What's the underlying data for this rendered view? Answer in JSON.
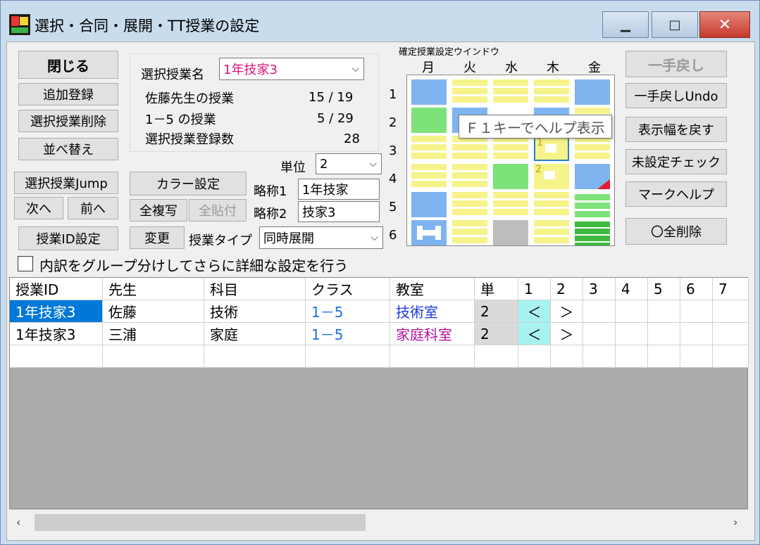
{
  "window": {
    "title": "選択・合同・展開・TT授業の設定",
    "min_glyph": "▁",
    "max_glyph": "□",
    "close_glyph": "✕"
  },
  "left_buttons": {
    "close": "閉じる",
    "add": "追加登録",
    "delete": "選択授業削除",
    "sort": "並べ替え",
    "jump": "選択授業Jump",
    "next": "次へ",
    "prev": "前へ",
    "lesson_id": "授業ID設定"
  },
  "group": {
    "select_label": "選択授業名",
    "select_value": "1年技家3",
    "row1_label": "佐藤先生の授業",
    "row1_value": "15 / 19",
    "row2_label": "1－5 の授業",
    "row2_value": "5 / 29",
    "row3_label": "選択授業登録数",
    "row3_value": "28"
  },
  "unit": {
    "label": "単位",
    "value": "2"
  },
  "mid_buttons": {
    "color": "カラー設定",
    "copy_all": "全複写",
    "paste_all": "全貼付",
    "change": "変更"
  },
  "abbr": {
    "label1": "略称1",
    "value1": "1年技家",
    "label2": "略称2",
    "value2": "技家3"
  },
  "lesson_type": {
    "label": "授業タイプ",
    "value": "同時展開"
  },
  "checkbox_label": "内訳をグループ分けしてさらに詳細な設定を行う",
  "timetable": {
    "title": "確定授業設定ウインドウ",
    "days": [
      "月",
      "火",
      "水",
      "木",
      "金"
    ],
    "periods": [
      "1",
      "2",
      "3",
      "4",
      "5",
      "6"
    ],
    "marker1": "1",
    "marker2": "2",
    "colors": {
      "blue": "#7fb3f0",
      "green": "#7ee27a",
      "yellow": "#f6f38a",
      "gray": "#bdbdbd",
      "red": "#e8192c"
    }
  },
  "tooltip": "Ｆ１キーでヘルプ表示",
  "right_buttons": {
    "undo": "一手戻し",
    "undo_undo": "一手戻しUndo",
    "restore_width": "表示幅を戻す",
    "unset_check": "未設定チェック",
    "mark_help": "マークヘルプ",
    "delete_all": "〇全削除"
  },
  "grid": {
    "headers": [
      "授業ID",
      "先生",
      "科目",
      "クラス",
      "教室",
      "単",
      "1",
      "2",
      "3",
      "4",
      "5",
      "6",
      "7"
    ],
    "rows": [
      {
        "id": "1年技家3",
        "teacher": "佐藤",
        "subject": "技術",
        "class": "1－5",
        "room": "技術室",
        "unit": "2",
        "c1": "＜",
        "c2": "＞"
      },
      {
        "id": "1年技家3",
        "teacher": "三浦",
        "subject": "家庭",
        "class": "1－5",
        "room": "家庭科室",
        "unit": "2",
        "c1": "＜",
        "c2": "＞"
      }
    ]
  },
  "scroll": {
    "left": "‹",
    "right": "›"
  }
}
